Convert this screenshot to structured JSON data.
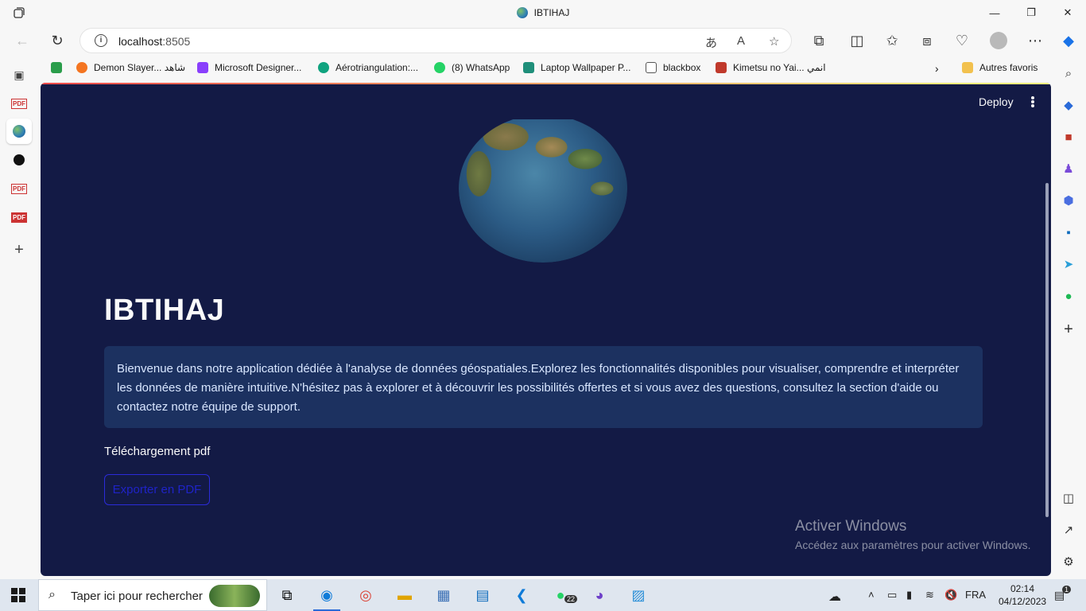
{
  "window": {
    "title": "IBTIHAJ",
    "controls": {
      "minimize": "—",
      "restore": "❐",
      "close": "✕"
    }
  },
  "address_bar": {
    "host": "localhost",
    "port": ":8505"
  },
  "bookmarks": [
    {
      "label": "",
      "color": "#2a9d4b"
    },
    {
      "label": "Demon Slayer... شاهد",
      "color": "#f47521"
    },
    {
      "label": "Microsoft Designer...",
      "color": "#8a3ffc"
    },
    {
      "label": "Aérotriangulation:...",
      "color": "#10a37f"
    },
    {
      "label": "(8) WhatsApp",
      "color": "#25d366"
    },
    {
      "label": "Laptop Wallpaper P...",
      "color": "#1f8f7a"
    },
    {
      "label": "blackbox",
      "color": "#555555"
    },
    {
      "label": "Kimetsu no Yai... انمي",
      "color": "#c0392b"
    }
  ],
  "bookmarks_more": "Autres favoris",
  "app": {
    "deploy_label": "Deploy",
    "title": "IBTIHAJ",
    "info_text": "Bienvenue dans notre application dédiée à l'analyse de données géospatiales.Explorez les fonctionnalités disponibles pour visualiser, comprendre et interpréter les données de manière intuitive.N'hésitez pas à explorer et à découvrir les possibilités offertes et si vous avez des questions, consultez la section d'aide ou contactez notre équipe de support.",
    "section_label": "Téléchargement pdf",
    "export_button": "Exporter en PDF"
  },
  "watermark": {
    "line1": "Activer Windows",
    "line2": "Accédez aux paramètres pour activer Windows."
  },
  "taskbar": {
    "search_placeholder": "Taper ici pour rechercher",
    "language": "FRA",
    "time": "02:14",
    "date": "04/12/2023",
    "whatsapp_badge": "22",
    "notification_count": "1"
  },
  "colors": {
    "content_bg": "#131a45",
    "info_bg": "#1c3160",
    "button_border": "#2b2bd9"
  }
}
